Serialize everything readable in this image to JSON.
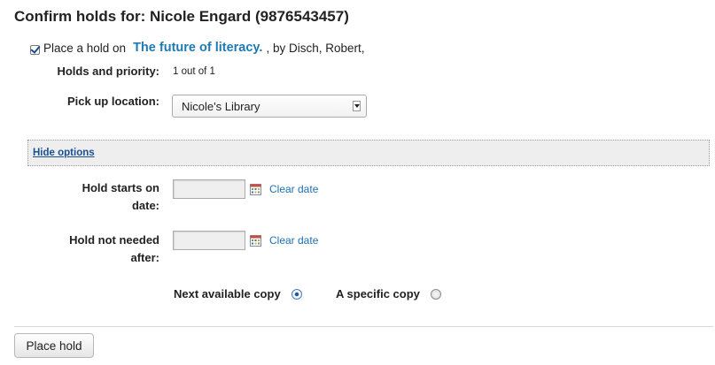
{
  "header": {
    "title": "Confirm holds for: Nicole Engard (9876543457)"
  },
  "hold": {
    "checked": true,
    "prefix": "Place a hold on",
    "title": "The future of literacy.",
    "author_suffix": ", by Disch, Robert,",
    "priority_label": "Holds and priority:",
    "priority_value": "1 out of 1",
    "pickup_label": "Pick up location:",
    "pickup_value": "Nicole's Library"
  },
  "options": {
    "toggle_label": "Hide options",
    "start_label_line1": "Hold starts on",
    "start_label_line2": "date:",
    "expire_label_line1": "Hold not needed",
    "expire_label_line2": "after:",
    "start_value": "",
    "expire_value": "",
    "clear_label": "Clear date",
    "next_copy_label": "Next available copy",
    "specific_copy_label": "A specific copy",
    "selected_option": "Next available copy"
  },
  "actions": {
    "submit_label": "Place hold"
  },
  "icons": {
    "date_picker": "calendar-icon",
    "select_arrow": "chevron-down-icon"
  },
  "colors": {
    "link": "#1f7ab4",
    "bar_background": "#eeeeee"
  }
}
